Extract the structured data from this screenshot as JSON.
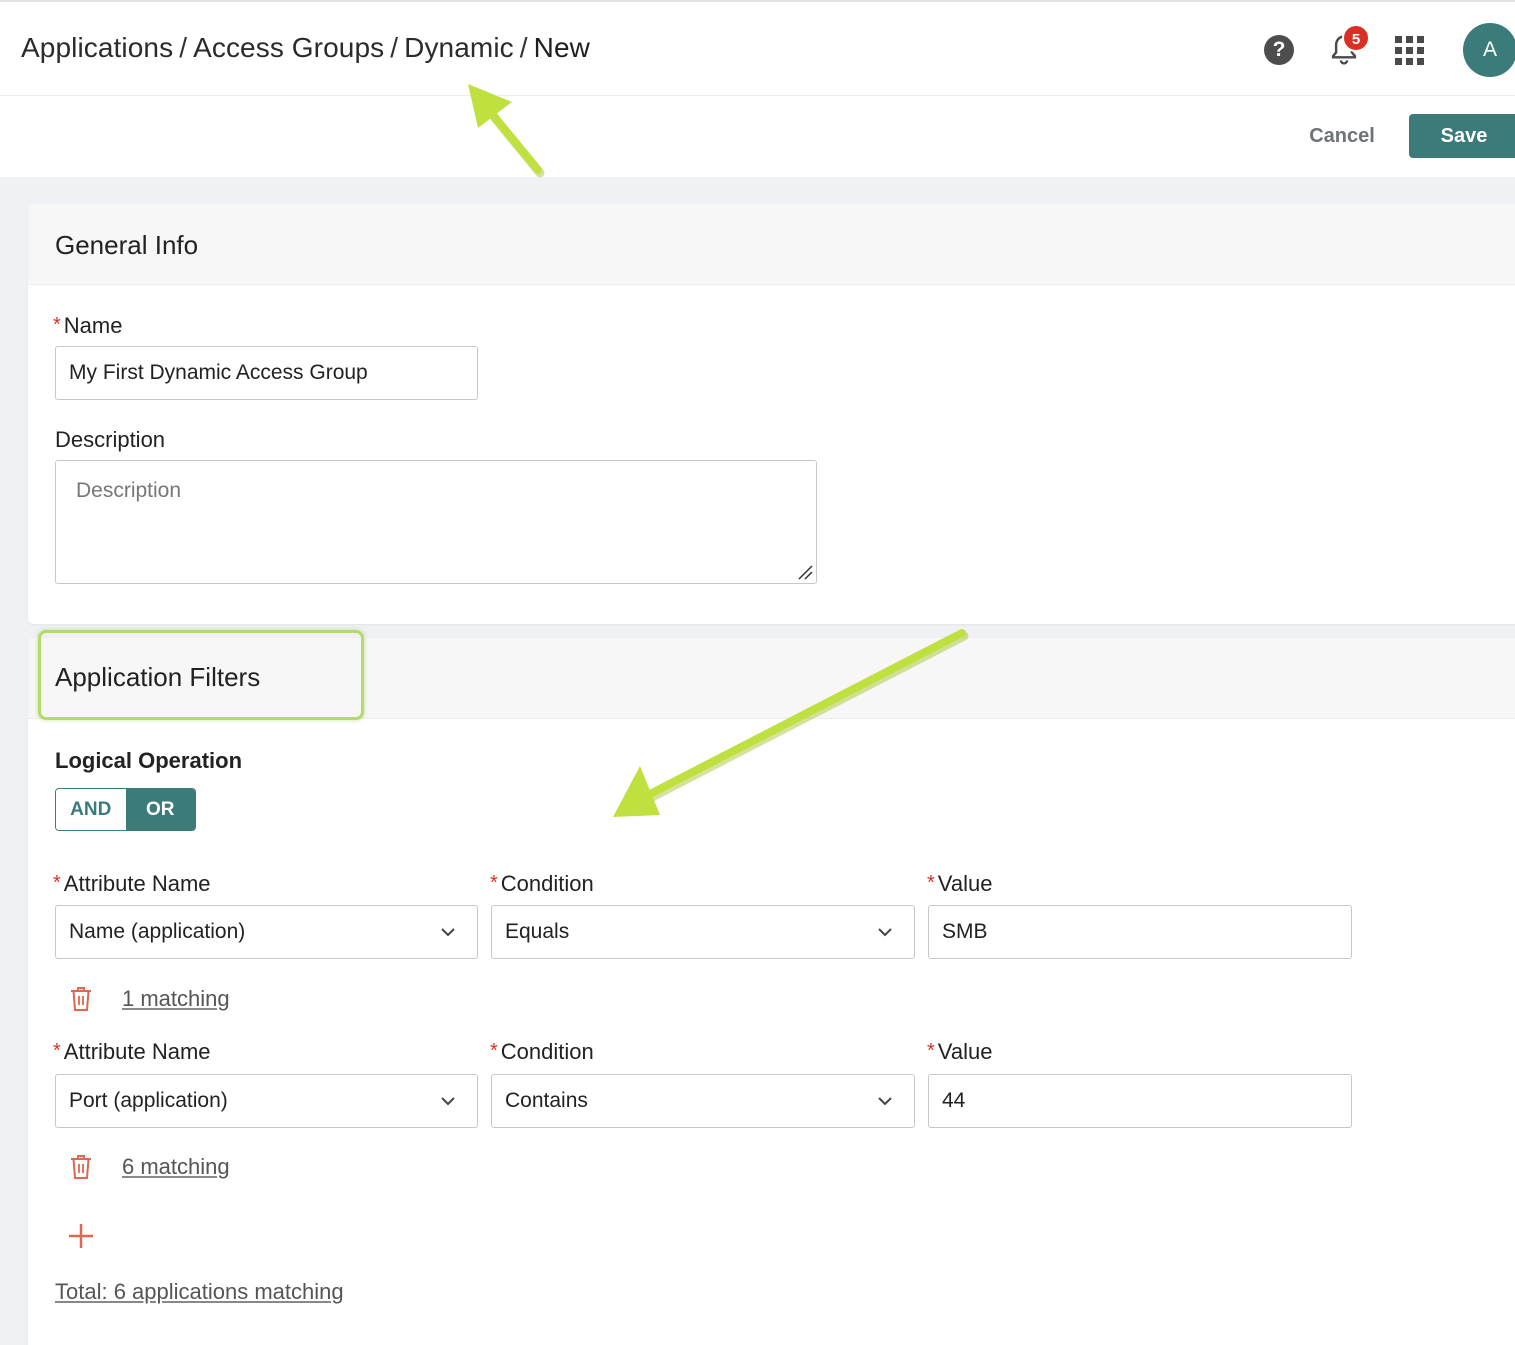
{
  "breadcrumb": {
    "items": [
      "Applications",
      "Access Groups",
      "Dynamic"
    ],
    "current": "New",
    "separator": "/"
  },
  "header": {
    "help_icon": "help-icon",
    "help_glyph": "?",
    "notifications_count": "5",
    "avatar_initial": "A"
  },
  "toolbar": {
    "cancel_label": "Cancel",
    "save_label": "Save"
  },
  "general_info": {
    "title": "General Info",
    "name_label": "Name",
    "name_value": "My First Dynamic Access Group",
    "description_label": "Description",
    "description_placeholder": "Description"
  },
  "filters": {
    "title": "Application Filters",
    "logical_operation_label": "Logical Operation",
    "and_label": "AND",
    "or_label": "OR",
    "selected_operation": "OR",
    "attribute_label": "Attribute Name",
    "condition_label": "Condition",
    "value_label": "Value",
    "rows": [
      {
        "attribute": "Name (application)",
        "condition": "Equals",
        "value": "SMB",
        "matching": "1 matching"
      },
      {
        "attribute": "Port (application)",
        "condition": "Contains",
        "value": "44",
        "matching": "6 matching"
      }
    ],
    "total": "Total: 6 applications matching"
  },
  "colors": {
    "accent": "#3b7b7a",
    "required": "#d93025",
    "danger_icon": "#e0674f",
    "annotation": "#b9dd4a"
  }
}
